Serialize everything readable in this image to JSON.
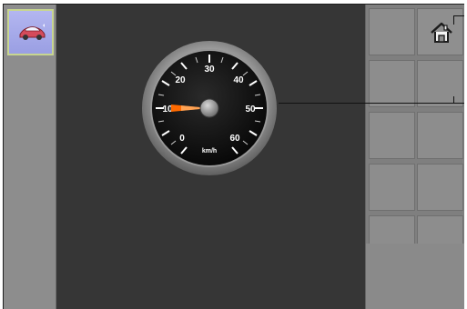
{
  "screen": {
    "title": "",
    "status": ""
  },
  "left_rail": {
    "app_icon": {
      "name": "car-icon",
      "color": "#d44b5b"
    }
  },
  "gauge": {
    "unit": "km/h",
    "ticks": [
      "0",
      "10",
      "20",
      "30",
      "40",
      "50",
      "60"
    ],
    "needle_value": 10,
    "needle_color": "#ff6a00"
  },
  "right_panel": {
    "home_icon": "home-icon"
  }
}
